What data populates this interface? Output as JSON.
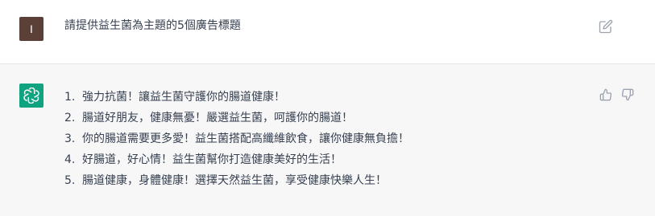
{
  "user_message": {
    "avatar_letter": "I",
    "text": "請提供益生菌為主題的5個廣告標題"
  },
  "assistant_message": {
    "items": [
      {
        "number": "1.",
        "text": "強力抗菌！讓益生菌守護你的腸道健康！"
      },
      {
        "number": "2.",
        "text": "腸道好朋友，健康無憂！嚴選益生菌，呵護你的腸道！"
      },
      {
        "number": "3.",
        "text": "你的腸道需要更多愛！益生菌搭配高纖維飲食，讓你健康無負擔！"
      },
      {
        "number": "4.",
        "text": "好腸道，好心情！益生菌幫你打造健康美好的生活！"
      },
      {
        "number": "5.",
        "text": "腸道健康，身體健康！選擇天然益生菌，享受健康快樂人生！"
      }
    ]
  },
  "icons": {
    "edit": "edit-icon",
    "assistant_logo": "openai-logo-icon",
    "thumbs_up": "thumbs-up-icon",
    "thumbs_down": "thumbs-down-icon"
  },
  "colors": {
    "user_avatar_bg": "#5b4037",
    "assistant_avatar_bg": "#10a37f",
    "assistant_row_bg": "#f7f7f8",
    "text": "#374151"
  }
}
